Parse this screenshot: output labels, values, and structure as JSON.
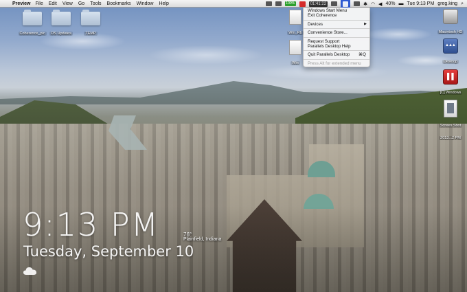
{
  "menubar": {
    "app_name": "Preview",
    "menus": [
      "File",
      "Edit",
      "View",
      "Go",
      "Tools",
      "Bookmarks",
      "Window",
      "Help"
    ],
    "status": {
      "battery_box": "100%",
      "clock_box": "01:41:22",
      "battery_percent": "40%",
      "datetime": "Tue 9:13 PM",
      "user": "greg.king"
    }
  },
  "parallels_menu": {
    "items": [
      {
        "label": "Windows Start Menu"
      },
      {
        "label": "Exit Coherence"
      },
      {
        "label": "Devices",
        "submenu": true
      },
      {
        "label": "Convenience Store..."
      },
      {
        "label": "Request Support"
      },
      {
        "label": "Parallels Desktop Help"
      },
      {
        "label": "Quit Parallels Desktop",
        "shortcut": "⌘Q"
      },
      {
        "label": "Press Alt for extended menu",
        "disabled": true
      }
    ]
  },
  "desktop_icons": {
    "folder1": "Coherence_pic",
    "folder2": "OS Updates",
    "folder3": "TEMP",
    "partial1": "Win_Rb",
    "partial2": "Win",
    "drive": "Macintosh HD",
    "parallels_drive": "Desktop",
    "windows_drive": "[C] Windows",
    "screenshot": "Screen Shot",
    "screenshot_date": "2013...2 PM"
  },
  "clock_widget": {
    "time": "9:13 PM",
    "date": "Tuesday, September 10",
    "temperature": "76°",
    "location": "Plainfield, Indiana"
  },
  "colors": {
    "menubar_bg": "#dcdcdc",
    "highlight": "#2f5bd3",
    "battery_green": "#2da02d",
    "parallels_red": "#d52b2b"
  }
}
